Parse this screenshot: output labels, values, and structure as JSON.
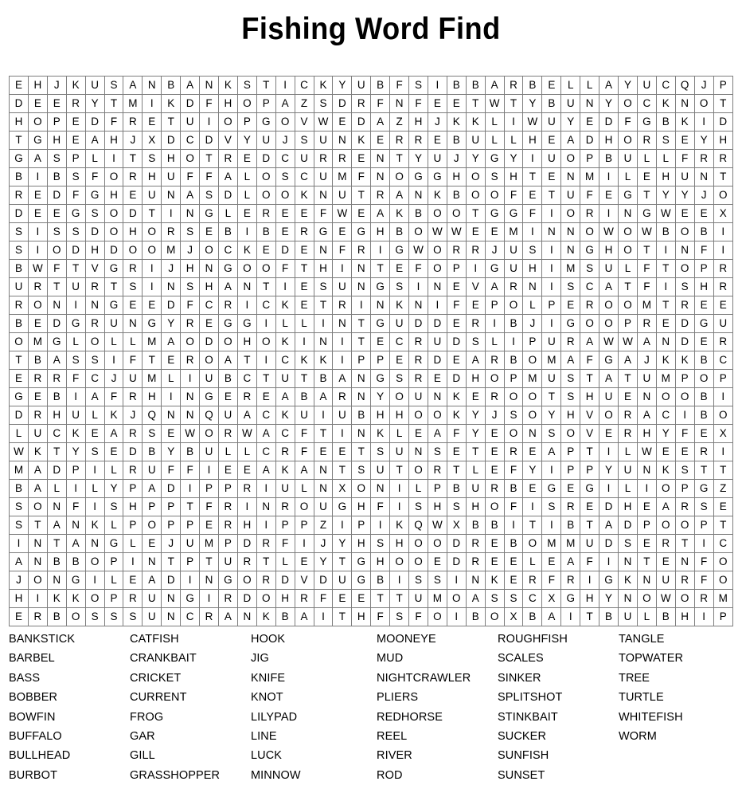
{
  "title": "Fishing Word Find",
  "grid": {
    "rows": 30,
    "cols": 39,
    "letters": [
      "EHJKUSANBANKSTICKYUBFSIBBARBELLAYUCQJP",
      "DEERYTMIKDFHOPAZSDRFNFEETWTYBUNYOCKNOT",
      "HOPEDFRETUIOPGOVWEDAZHJKKLIWUYEDFGBKID",
      "TGHEAHJXDCDVYUJSUNKERREBULLHEADHORSEYH",
      "GASPLITSHOTREDCURRENTYUJYGYIUOPBULLFRR",
      "BIBSFORHUFFALOSCUMFNOGGHOSHTENMILEHUNT",
      "REDFGHEUNASDLOOKNUTRANKBOOFETUFEGTYYJO",
      "DEEGSODTINGLEREEFWEAKBOOTGGFIORINGWEEX",
      "SISSDOHORSEBIBERGEGHBOWWEEMINNOWOWBOBI",
      "SIODHDOOMJOCKEDENFRIGWORRJUSINGHOTINFI",
      "BWFTVGRIJHNGOOFTHINTEFOPIGUHIMSULFTOPR",
      "URTURTSINSHANTIESUNGSINEVARNISCATFISHR",
      "RONINGEEDFCRICKETRINKNIFEPOLPEROOMTREE",
      "BEDGRUNGYREGGILLINTGUDDERIBJIGOOPREDGU",
      "OMGLOLLMAODOHOKINITECRUDSLIPURAWWANDER",
      "TBASSIFTEROATICKKIPPERDEARBOMAFGAJKKBC",
      "ERRFCJUMLIUBCTUTBANGSREDHOPMUSTATUMPOP",
      "GEBIAFRHINGEREABARNYOUNKEROOTSHUENOOBI",
      "DRHULKJQNNQUACKUIUBHHOOKYJSOYHVORACIBO",
      "LUCKEARSEWORWACFTINKLEAFYEONSOVERHYFEX",
      "WKTYSEDBYBULLCRFEETSUNSETEREAPTILWEERI",
      "MADPILRUFFIEEAKANTSUTORTLEFYIPPYUNKSTT",
      "BALILYPADIPPRIULNXONILPBURBEGEGILIOPGZ",
      "SONFISHPPTFRINROUGHFISHSHOFISREDHEARSE",
      "STANKLPOPPERHIPPZIPIKQWXBBITIBTADPOOPT",
      "INTANGLEJUMPDRFIJYHSHOODREBOMMUDSERTIC",
      "ANBBOPINTPTURTLEYTGHOOEDREELEAFINTENFO",
      "JONGILEADINGORDVDUGBISSINKERFRIGKNURFO",
      "HIKKOPRUNGIRDOHRFEETTUMOASSCXGHYNOWORM",
      "ERBOSSSUNCRANKBAITHFSFOIBOXBAITBULBHIP"
    ]
  },
  "word_list": {
    "columns": [
      [
        "BANKSTICK",
        "BARBEL",
        "BASS",
        "BOBBER",
        "BOWFIN",
        "BUFFALO",
        "BULLHEAD",
        "BURBOT"
      ],
      [
        "CATFISH",
        "CRANKBAIT",
        "CRICKET",
        "CURRENT",
        "FROG",
        "GAR",
        "GILL",
        "GRASSHOPPER"
      ],
      [
        "HOOK",
        "JIG",
        "KNIFE",
        "KNOT",
        "LILYPAD",
        "LINE",
        "LUCK",
        "MINNOW"
      ],
      [
        "MOONEYE",
        "MUD",
        "NIGHTCRAWLER",
        "PLIERS",
        "REDHORSE",
        "REEL",
        "RIVER",
        "ROD"
      ],
      [
        "ROUGHFISH",
        "SCALES",
        "SINKER",
        "SPLITSHOT",
        "STINKBAIT",
        "SUCKER",
        "SUNFISH",
        "SUNSET"
      ],
      [
        "TANGLE",
        "TOPWATER",
        "TREE",
        "TURTLE",
        "WHITEFISH",
        "WORM"
      ]
    ]
  },
  "colors": {
    "text": "#000000",
    "grid_line": "#7d7d7d",
    "background": "#ffffff"
  }
}
